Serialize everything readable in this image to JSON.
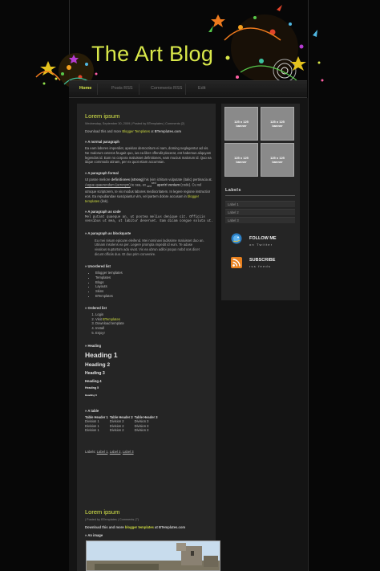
{
  "blog": {
    "title": "The Art Blog"
  },
  "nav": {
    "items": [
      "Home",
      "Posts RSS",
      "Comments RSS",
      "Edit"
    ]
  },
  "post1": {
    "title": "Lorem ipsum",
    "meta": "Wednesday, September 30, 2009 | Posted by BTemplates | Comments (2)",
    "intro_pre": "Download this and more ",
    "intro_link": "Blogger Templates",
    "intro_mid": " at ",
    "intro_site": "BTemplates.com",
    "normal_head": "» A normal paragraph",
    "normal_text": "Ea eam labores imperdiet, apeirian democritum ei nam, doming neglegentur ad vis. Ne malorum ceteros feugait quo, ius ea liber offendit placerat, est habemus aliquyam legendos id. Eam no corpora maluisset definitiones, eam mucius malorum id. Quo ea idque commodo utinam, per ex quot etiam accumsan.",
    "formal_head": "» A paragraph formal",
    "formal_t1": "Ut posse meliore ",
    "formal_strong": "definitiones (strong)",
    "formal_t2": " his (vim ichitam vulputate (italic) pertinacia at. ",
    "formal_u": "Augue quaerendum (acronym)",
    "formal_t3": " te sea, ex ",
    "formal_sub": "sed",
    "formal_sup": "sed",
    "formal_t4": " ",
    "formal_b2": "aperiri veniam",
    "formal_t5": " (code). Cu vel utroque scriptorem, te vix modus labores mediocritatem. In legere regione instructior eos. Ea repudiandae suscipiantur vim, vel partem dolore accusam in ",
    "formal_link": "blogger templates",
    "formal_t6": " (link).",
    "code_head": "» A paragraph as code",
    "code_text": "Mel putant quaeque an, ut postea melius denique cit. Officiis sensibus ut mea, ut labitur deseruet. Eam dicam congue soluta ut.",
    "quote_head": "» A paragraph as blockquote",
    "quote_text": "Eu mei nisum epicurei eleifend. Mei nominavi ladissime maluisset duo an. Utinam insolens ea per. Legere prompta impedit id eum. Te adase vivalous suptortom adu vivat. Vix ea ubrun adiloi poquo nobd oos dicet dicunt officiis duo. Et duo prim convenire.",
    "ul_head": "» Unordered list",
    "ul_items": [
      "Blogger templates",
      "Templates",
      "Blogs",
      "Layouts",
      "Skins",
      "BTemplates"
    ],
    "ol_head": "» Ordered list",
    "ol_items": [
      "Login",
      "Visit ",
      "Download template",
      "Install",
      "Enjoy!"
    ],
    "ol_link": "BTemplates",
    "heading_head": "» Heading",
    "h1": "Heading 1",
    "h2": "Heading 2",
    "h3": "Heading 3",
    "h4": "Heading 4",
    "h5": "Heading 5",
    "h6": "Heading 6",
    "table_head": "» A table",
    "table_headers": [
      "Table Header 1",
      "Table Header 2",
      "Table Header 3"
    ],
    "table_rows": [
      [
        "Division 1",
        "Division 2",
        "Division 3"
      ],
      [
        "Division 1",
        "Division 2",
        "Division 3"
      ],
      [
        "Division 1",
        "Division 2",
        "Division 3"
      ]
    ],
    "labels_prefix": "Labels: ",
    "labels": [
      "Label 1",
      "Label 2",
      "Label 3"
    ]
  },
  "post2": {
    "title": "Lorem ipsum",
    "meta": "| Posted by BTemplates | Comments (7)",
    "intro_pre": "Download this and more ",
    "intro_link": "blogger templates",
    "intro_mid": " at ",
    "intro_site": "BTemplates.com",
    "image_head": "» An image"
  },
  "sidebar": {
    "banner_text": "125 x 125\nbanner",
    "labels_title": "Labels",
    "labels": [
      "Label 1",
      "Label 2",
      "Label 3"
    ],
    "follow_title": "FOLLOW ME",
    "follow_sub": "on Twitter",
    "subscribe_title": "SUBSCRIBE",
    "subscribe_sub": "rss feeds"
  },
  "colors": {
    "accent": "#d9e84a",
    "background": "#070707",
    "panel": "#252525"
  }
}
